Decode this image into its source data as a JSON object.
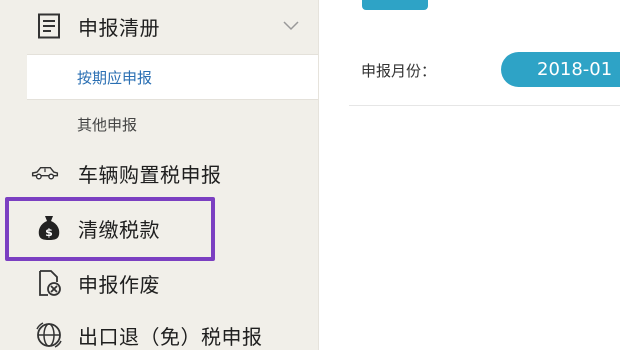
{
  "sidebar": {
    "declaration_list": {
      "label": "申报清册",
      "icon": "document-list-icon"
    },
    "submenu": [
      {
        "label": "按期应申报",
        "active": true
      },
      {
        "label": "其他申报",
        "active": false
      }
    ],
    "items": [
      {
        "label": "车辆购置税申报",
        "icon": "car-icon"
      },
      {
        "label": "清缴税款",
        "icon": "money-bag-icon"
      },
      {
        "label": "申报作废",
        "icon": "void-document-icon"
      },
      {
        "label": "出口退（免）税申报",
        "icon": "globe-icon"
      }
    ]
  },
  "main": {
    "period_label": "申报月份：",
    "period_value": "2018-01"
  },
  "colors": {
    "accent": "#2ea3c6",
    "highlight": "#7b3fc1",
    "sidebar_bg": "#f1efe9",
    "active_link": "#2a6fb3"
  }
}
